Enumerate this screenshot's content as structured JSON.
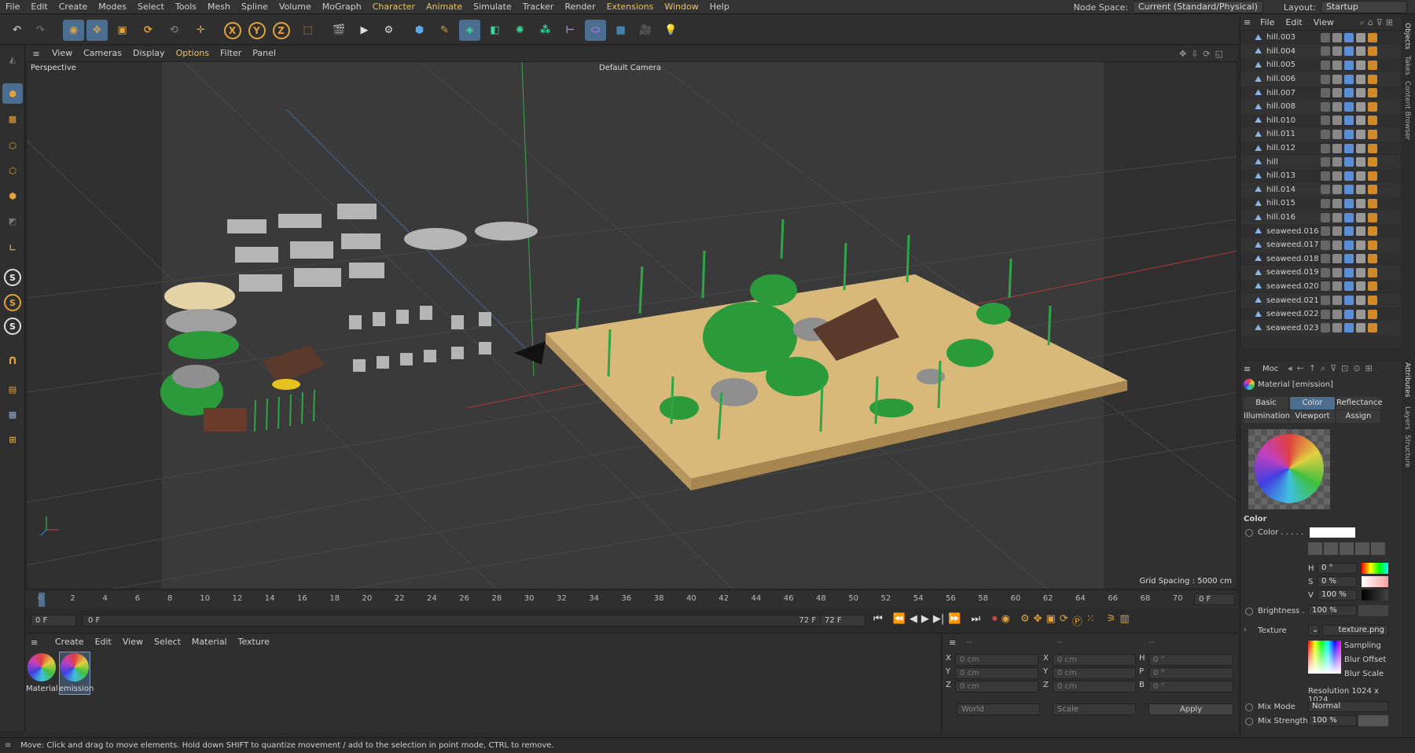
{
  "menu": [
    "File",
    "Edit",
    "Create",
    "Modes",
    "Select",
    "Tools",
    "Mesh",
    "Spline",
    "Volume",
    "MoGraph",
    "Character",
    "Animate",
    "Simulate",
    "Tracker",
    "Render",
    "Extensions",
    "Window",
    "Help"
  ],
  "node_space": {
    "label": "Node Space:",
    "value": "Current (Standard/Physical)"
  },
  "layout": {
    "label": "Layout:",
    "value": "Startup"
  },
  "axis_buttons": [
    "X",
    "Y",
    "Z"
  ],
  "snap_labels": [
    "S",
    "S",
    "S"
  ],
  "viewport_menu": [
    "View",
    "Cameras",
    "Display",
    "Options",
    "Filter",
    "Panel"
  ],
  "viewport": {
    "title": "Perspective",
    "camera": "Default Camera",
    "grid_spacing": "Grid Spacing : 5000 cm"
  },
  "timeline": {
    "ticks": [
      "0",
      "2",
      "4",
      "6",
      "8",
      "10",
      "12",
      "14",
      "16",
      "18",
      "20",
      "22",
      "24",
      "26",
      "28",
      "30",
      "32",
      "34",
      "36",
      "38",
      "40",
      "42",
      "44",
      "46",
      "48",
      "50",
      "52",
      "54",
      "56",
      "58",
      "60",
      "62",
      "64",
      "66",
      "68",
      "70",
      "72"
    ],
    "current_frame": "0 F",
    "start_field": "0 F",
    "range_start": "0 F",
    "range_end": "72 F",
    "end_field": "72 F"
  },
  "material_menu": [
    "Create",
    "Edit",
    "View",
    "Select",
    "Material",
    "Texture"
  ],
  "materials": [
    {
      "name": "Material"
    },
    {
      "name": "emission"
    }
  ],
  "coords": {
    "rows": [
      {
        "a": "X",
        "av": "0 cm",
        "b": "X",
        "bv": "0 cm",
        "c": "H",
        "cv": "0 °"
      },
      {
        "a": "Y",
        "av": "0 cm",
        "b": "Y",
        "bv": "0 cm",
        "c": "P",
        "cv": "0 °"
      },
      {
        "a": "Z",
        "av": "0 cm",
        "b": "Z",
        "bv": "0 cm",
        "c": "B",
        "cv": "0 °"
      }
    ],
    "mode": "World",
    "scale": "Scale",
    "apply": "Apply",
    "headers": [
      "--",
      "--",
      "--"
    ]
  },
  "status": "Move: Click and drag to move elements. Hold down SHIFT to quantize movement / add to the selection in point mode, CTRL to remove.",
  "objects_menu": [
    "File",
    "Edit",
    "View"
  ],
  "objects": [
    "hill.003",
    "hill.004",
    "hill.005",
    "hill.006",
    "hill.007",
    "hill.008",
    "hill.010",
    "hill.011",
    "hill.012",
    "hill",
    "hill.013",
    "hill.014",
    "hill.015",
    "hill.016",
    "seaweed.016",
    "seaweed.017",
    "seaweed.018",
    "seaweed.019",
    "seaweed.020",
    "seaweed.021",
    "seaweed.022",
    "seaweed.023"
  ],
  "attributes": {
    "mode": "Moc",
    "title": "Material [emission]",
    "tabs_row1": [
      "Basic",
      "Color",
      "Reflectance"
    ],
    "tabs_row2": [
      "Illumination",
      "Viewport",
      "Assign"
    ],
    "section": "Color",
    "color_label": "Color . . . . .",
    "h_label": "H",
    "h_value": "0 °",
    "s_label": "S",
    "s_value": "0 %",
    "v_label": "V",
    "v_value": "100 %",
    "brightness_label": "Brightness . .",
    "brightness_value": "100 %",
    "texture_label": "Texture",
    "texture_value": "texture.png",
    "sampling": "Sampling",
    "blur_offset": "Blur Offset",
    "blur_scale": "Blur Scale",
    "resolution": "Resolution 1024 x 1024,",
    "mix_mode_label": "Mix Mode",
    "mix_mode_value": "Normal",
    "mix_strength_label": "Mix Strength",
    "mix_strength_value": "100 %"
  },
  "side_tabs": [
    "Objects",
    "Takes",
    "Content Browser",
    "Attributes",
    "Layers",
    "Structure"
  ],
  "colors": {
    "accent": "#4b6d8f",
    "orange": "#e3a23b",
    "sand": "#d9b97a",
    "grass": "#2a9a3a"
  }
}
